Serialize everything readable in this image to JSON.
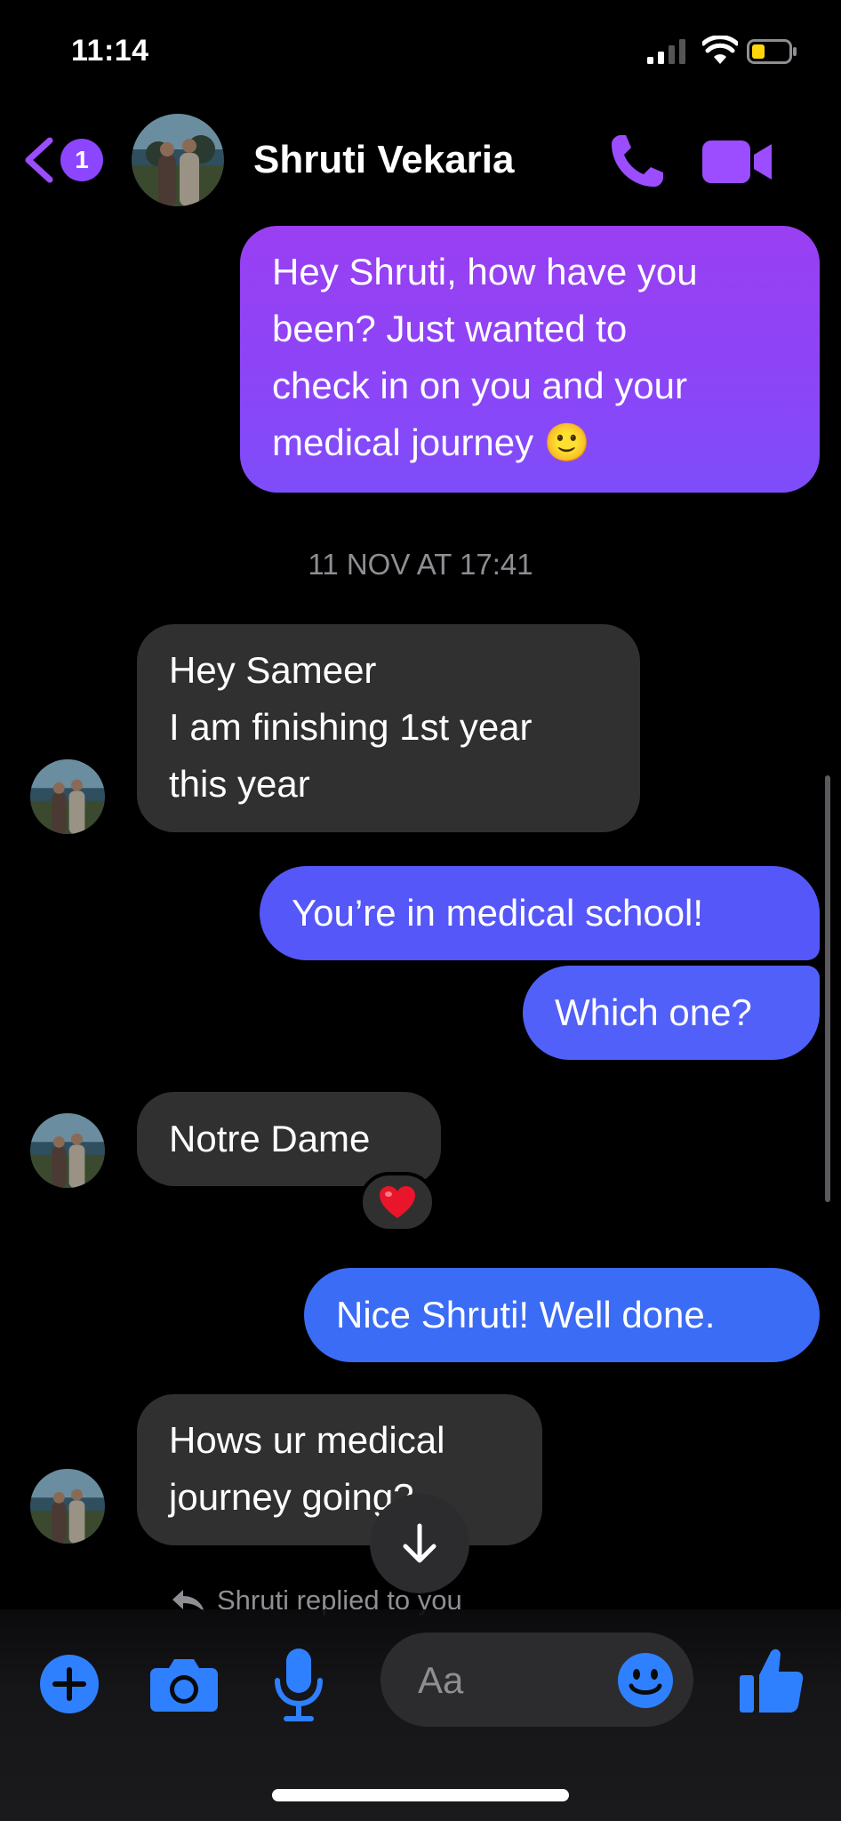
{
  "status_bar": {
    "time": "11:14"
  },
  "header": {
    "unread_count": "1",
    "contact_name": "Shruti Vekaria"
  },
  "messages": {
    "out_1": {
      "lines": [
        "Hey Shruti, how have you",
        "been? Just wanted to",
        "check in on you and your",
        "medical journey 🙂"
      ]
    },
    "timestamp": "11 NOV AT 17:41",
    "in_1": {
      "lines": [
        "Hey Sameer",
        "I am finishing 1st year",
        "this year"
      ]
    },
    "out_2": "You’re in medical school!",
    "out_3": "Which one?",
    "in_2": "Notre Dame",
    "in_2_reaction": "❤️",
    "out_4": "Nice Shruti! Well done.",
    "in_3": {
      "lines": [
        "Hows ur medical",
        "journey going?"
      ]
    },
    "reply_note": "Shruti replied to you"
  },
  "composer": {
    "placeholder": "Aa"
  },
  "colors": {
    "accent_purple": "#8c46ff",
    "outgoing_gradient_top": "#9a3ff2",
    "outgoing_blue": "#3b6cf6",
    "incoming_bubble": "#303030",
    "composer_icon_blue": "#2f80ff"
  },
  "icons": {
    "back": "chevron-left-icon",
    "phone": "phone-icon",
    "video": "video-camera-icon",
    "plus": "plus-circle-icon",
    "camera": "camera-icon",
    "mic": "microphone-icon",
    "emoji": "smiley-icon",
    "like": "thumbs-up-icon",
    "scroll": "arrow-down-icon",
    "reply": "reply-arrow-icon"
  }
}
